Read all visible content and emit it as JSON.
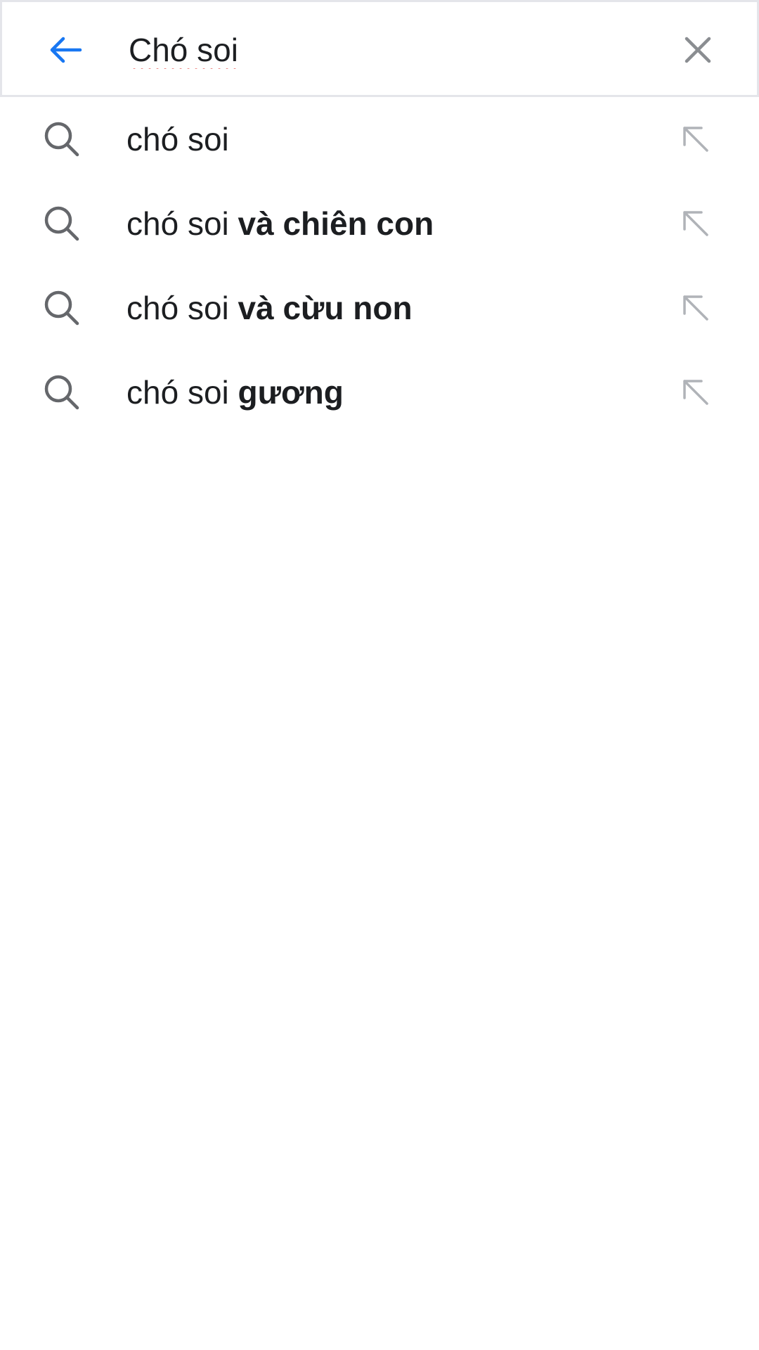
{
  "colors": {
    "accent": "#1877f2",
    "text": "#1c1e21",
    "icon_gray": "#65676b",
    "arrow_gray": "#b0b3b8",
    "spell_underline": "#e0312b"
  },
  "search": {
    "value": "Chó soi",
    "back_icon": "arrow-left-icon",
    "clear_icon": "close-icon"
  },
  "suggestions": [
    {
      "prefix": "chó soi",
      "completion": "",
      "icon": "search-icon",
      "action_icon": "arrow-up-left-icon"
    },
    {
      "prefix": "chó soi ",
      "completion": "và chiên con",
      "icon": "search-icon",
      "action_icon": "arrow-up-left-icon"
    },
    {
      "prefix": "chó soi ",
      "completion": "và cừu non",
      "icon": "search-icon",
      "action_icon": "arrow-up-left-icon"
    },
    {
      "prefix": "chó soi ",
      "completion": "gương",
      "icon": "search-icon",
      "action_icon": "arrow-up-left-icon"
    }
  ]
}
